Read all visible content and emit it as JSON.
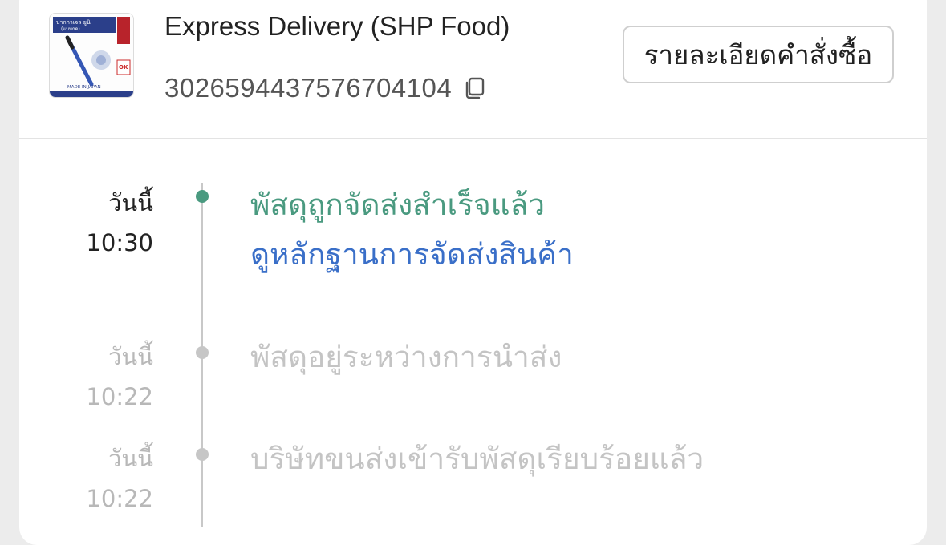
{
  "shipment": {
    "provider": "Express Delivery (SHP Food)",
    "tracking_number": "302659443757670410 4",
    "details_button_label": "รายละเอียดคำสั่งซื้อ"
  },
  "thumbnail": {
    "title": "ปากกาเจล ยูนิ",
    "subtitle": "(แบบกด)",
    "badge": "OK",
    "made_in": "MADE IN JAPAN"
  },
  "timeline": [
    {
      "day": "วันนี้",
      "time": "10:30",
      "status": "พัสดุถูกจัดส่งสำเร็จแล้ว",
      "link": "ดูหลักฐานการจัดส่งสินค้า",
      "state": "active"
    },
    {
      "day": "วันนี้",
      "time": "10:22",
      "status": "พัสดุอยู่ระหว่างการนำส่ง",
      "state": "inactive"
    },
    {
      "day": "วันนี้",
      "time": "10:22",
      "status": "บริษัทขนส่งเข้ารับพัสดุเรียบร้อยแล้ว",
      "state": "inactive"
    }
  ],
  "colors": {
    "accent_green": "#4a9a80",
    "link_blue": "#3a6fc8",
    "inactive_gray": "#c4c4c4"
  },
  "icons": {
    "copy": "copy-icon"
  }
}
